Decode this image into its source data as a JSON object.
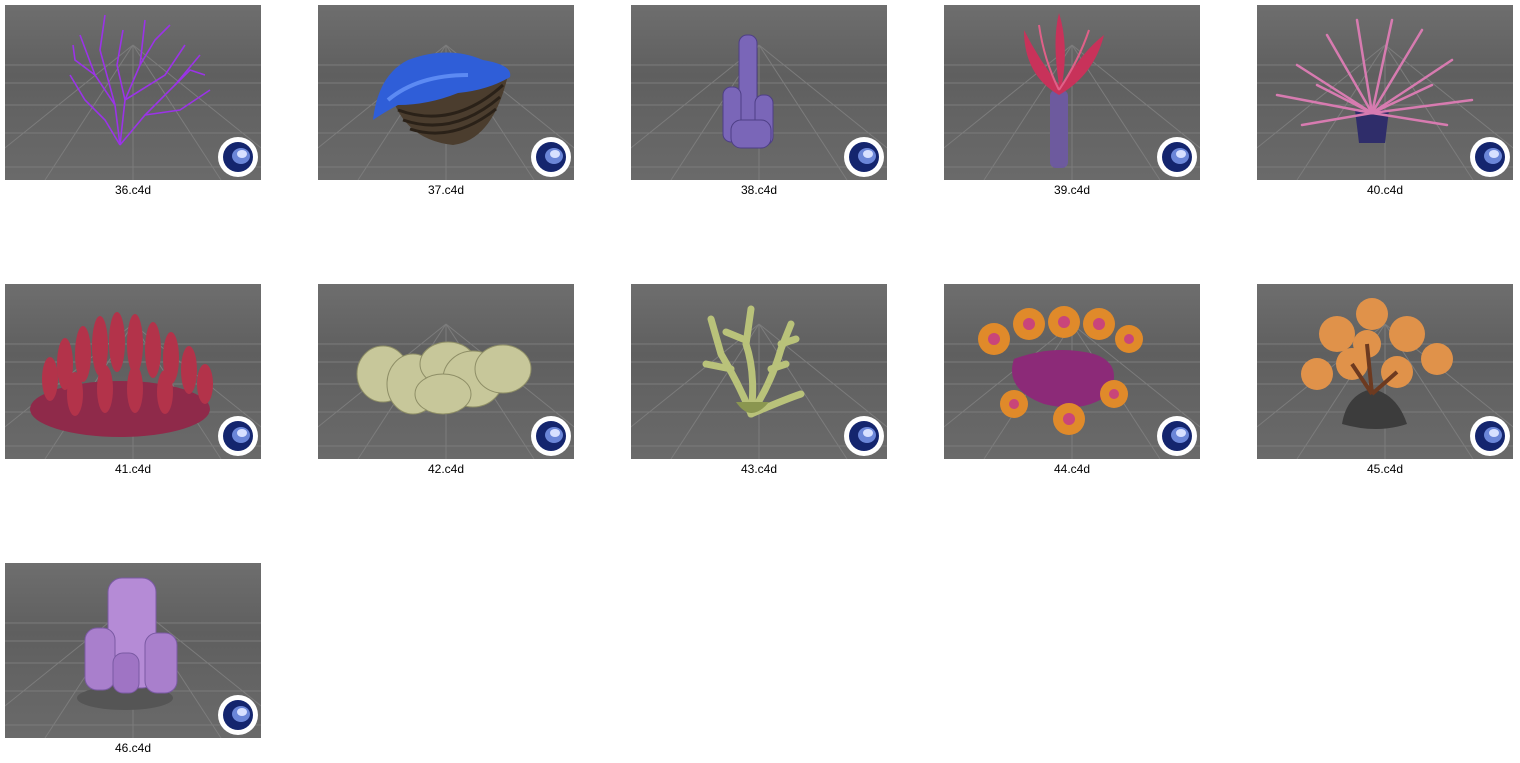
{
  "files": [
    {
      "name": "36.c4d",
      "model": "sea-fan",
      "color": "#9b33e8"
    },
    {
      "name": "37.c4d",
      "model": "giant-clam",
      "color": "#2f5ed8"
    },
    {
      "name": "38.c4d",
      "model": "tube-sponge",
      "color": "#7a66b8"
    },
    {
      "name": "39.c4d",
      "model": "tube-anemone",
      "color": "#c8325a"
    },
    {
      "name": "40.c4d",
      "model": "spiky-anemone",
      "color": "#d77bb0"
    },
    {
      "name": "41.c4d",
      "model": "finger-coral",
      "color": "#b3334a"
    },
    {
      "name": "42.c4d",
      "model": "brain-coral",
      "color": "#c7c79a"
    },
    {
      "name": "43.c4d",
      "model": "branching-coral",
      "color": "#b9c27a"
    },
    {
      "name": "44.c4d",
      "model": "sun-coral",
      "color": "#e08a2a"
    },
    {
      "name": "45.c4d",
      "model": "orange-coral",
      "color": "#e0924a"
    },
    {
      "name": "46.c4d",
      "model": "vase-sponge",
      "color": "#b58bd6"
    }
  ],
  "badge_icon": "cinema4d-logo-icon"
}
